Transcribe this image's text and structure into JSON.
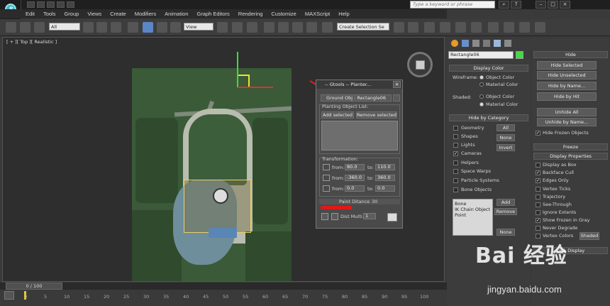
{
  "app": {
    "logo_letter": "S"
  },
  "titlebar": {
    "search_placeholder": "Type a keyword or phrase"
  },
  "menu": [
    "Edit",
    "Tools",
    "Group",
    "Views",
    "Create",
    "Modifiers",
    "Animation",
    "Graph Editors",
    "Rendering",
    "Customize",
    "MAXScript",
    "Help"
  ],
  "toolbar": {
    "selection_filter": "All",
    "ref_coord": "View",
    "named_selection": "Create Selection Se"
  },
  "viewport": {
    "label": "[ + ][ Top ][ Realistic ]"
  },
  "dialog": {
    "title": "-- Gtools -- Planter...",
    "close": "×",
    "ground_obj": "Ground Obj : Rectangle06",
    "planting_list_label": "Planting Object List:",
    "add_selected": "Add selected",
    "remove_selected": "Remove selected",
    "transformation_label": "Transformation:",
    "from_label": "from:",
    "to_label": "to:",
    "rows": [
      {
        "from": "80.0",
        "to": "110.0"
      },
      {
        "from": "-360.0",
        "to": "360.0"
      },
      {
        "from": "0.0",
        "to": "0.0"
      }
    ],
    "paint_distance_label": "Paint Ditance",
    "paint_distance_value": "30",
    "dist_mult_label": "Dist Multi.",
    "dist_mult_value": "1"
  },
  "command_panel": {
    "object_name": "Rectangle06",
    "object_color": "#3ede3e",
    "display_color_header": "Display Color",
    "wireframe_label": "Wireframe:",
    "shaded_label": "Shaded:",
    "object_color_option": "Object Color",
    "material_color_option": "Material Color",
    "hide_by_category_header": "Hide by Category",
    "categories": [
      {
        "label": "Geometry",
        "checked": false
      },
      {
        "label": "Shapes",
        "checked": false
      },
      {
        "label": "Lights",
        "checked": false
      },
      {
        "label": "Cameras",
        "checked": true
      },
      {
        "label": "Helpers",
        "checked": false
      },
      {
        "label": "Space Warps",
        "checked": false
      },
      {
        "label": "Particle Systems",
        "checked": false
      },
      {
        "label": "Bone Objects",
        "checked": false
      }
    ],
    "all_button": "All",
    "none_button": "None",
    "invert_button": "Invert",
    "list_items": [
      "Bone",
      "IK Chain Object",
      "Point"
    ],
    "add_button": "Add",
    "remove_button": "Remove",
    "none_button2": "None"
  },
  "display_panel": {
    "hide_header": "Hide",
    "hide_buttons": [
      "Hide Selected",
      "Hide Unselected",
      "Hide by Name...",
      "Hide by Hit"
    ],
    "unhide_buttons": [
      "Unhide All",
      "Unhide by Name..."
    ],
    "hide_frozen_label": "Hide Frozen Objects",
    "freeze_header": "Freeze",
    "display_properties_header": "Display Properties",
    "properties": [
      {
        "label": "Display as Box",
        "checked": false
      },
      {
        "label": "Backface Cull",
        "checked": true
      },
      {
        "label": "Edges Only",
        "checked": true
      },
      {
        "label": "Vertex Ticks",
        "checked": false
      },
      {
        "label": "Trajectory",
        "checked": false
      },
      {
        "label": "See-Through",
        "checked": false
      },
      {
        "label": "Ignore Extents",
        "checked": false
      },
      {
        "label": "Show Frozen in Gray",
        "checked": true
      },
      {
        "label": "Never Degrade",
        "checked": false
      },
      {
        "label": "Vertex Colors",
        "checked": false
      }
    ],
    "shaded_button": "Shaded",
    "link_display_header": "Link Display"
  },
  "timeline": {
    "frame_counter": "0 / 100",
    "ticks": [
      "0",
      "5",
      "10",
      "15",
      "20",
      "25",
      "30",
      "35",
      "40",
      "45",
      "50",
      "55",
      "60",
      "65",
      "70",
      "75",
      "80",
      "85",
      "90",
      "95",
      "100"
    ]
  },
  "watermark": {
    "brand": "Bai 经验",
    "url": "jingyan.baidu.com"
  }
}
